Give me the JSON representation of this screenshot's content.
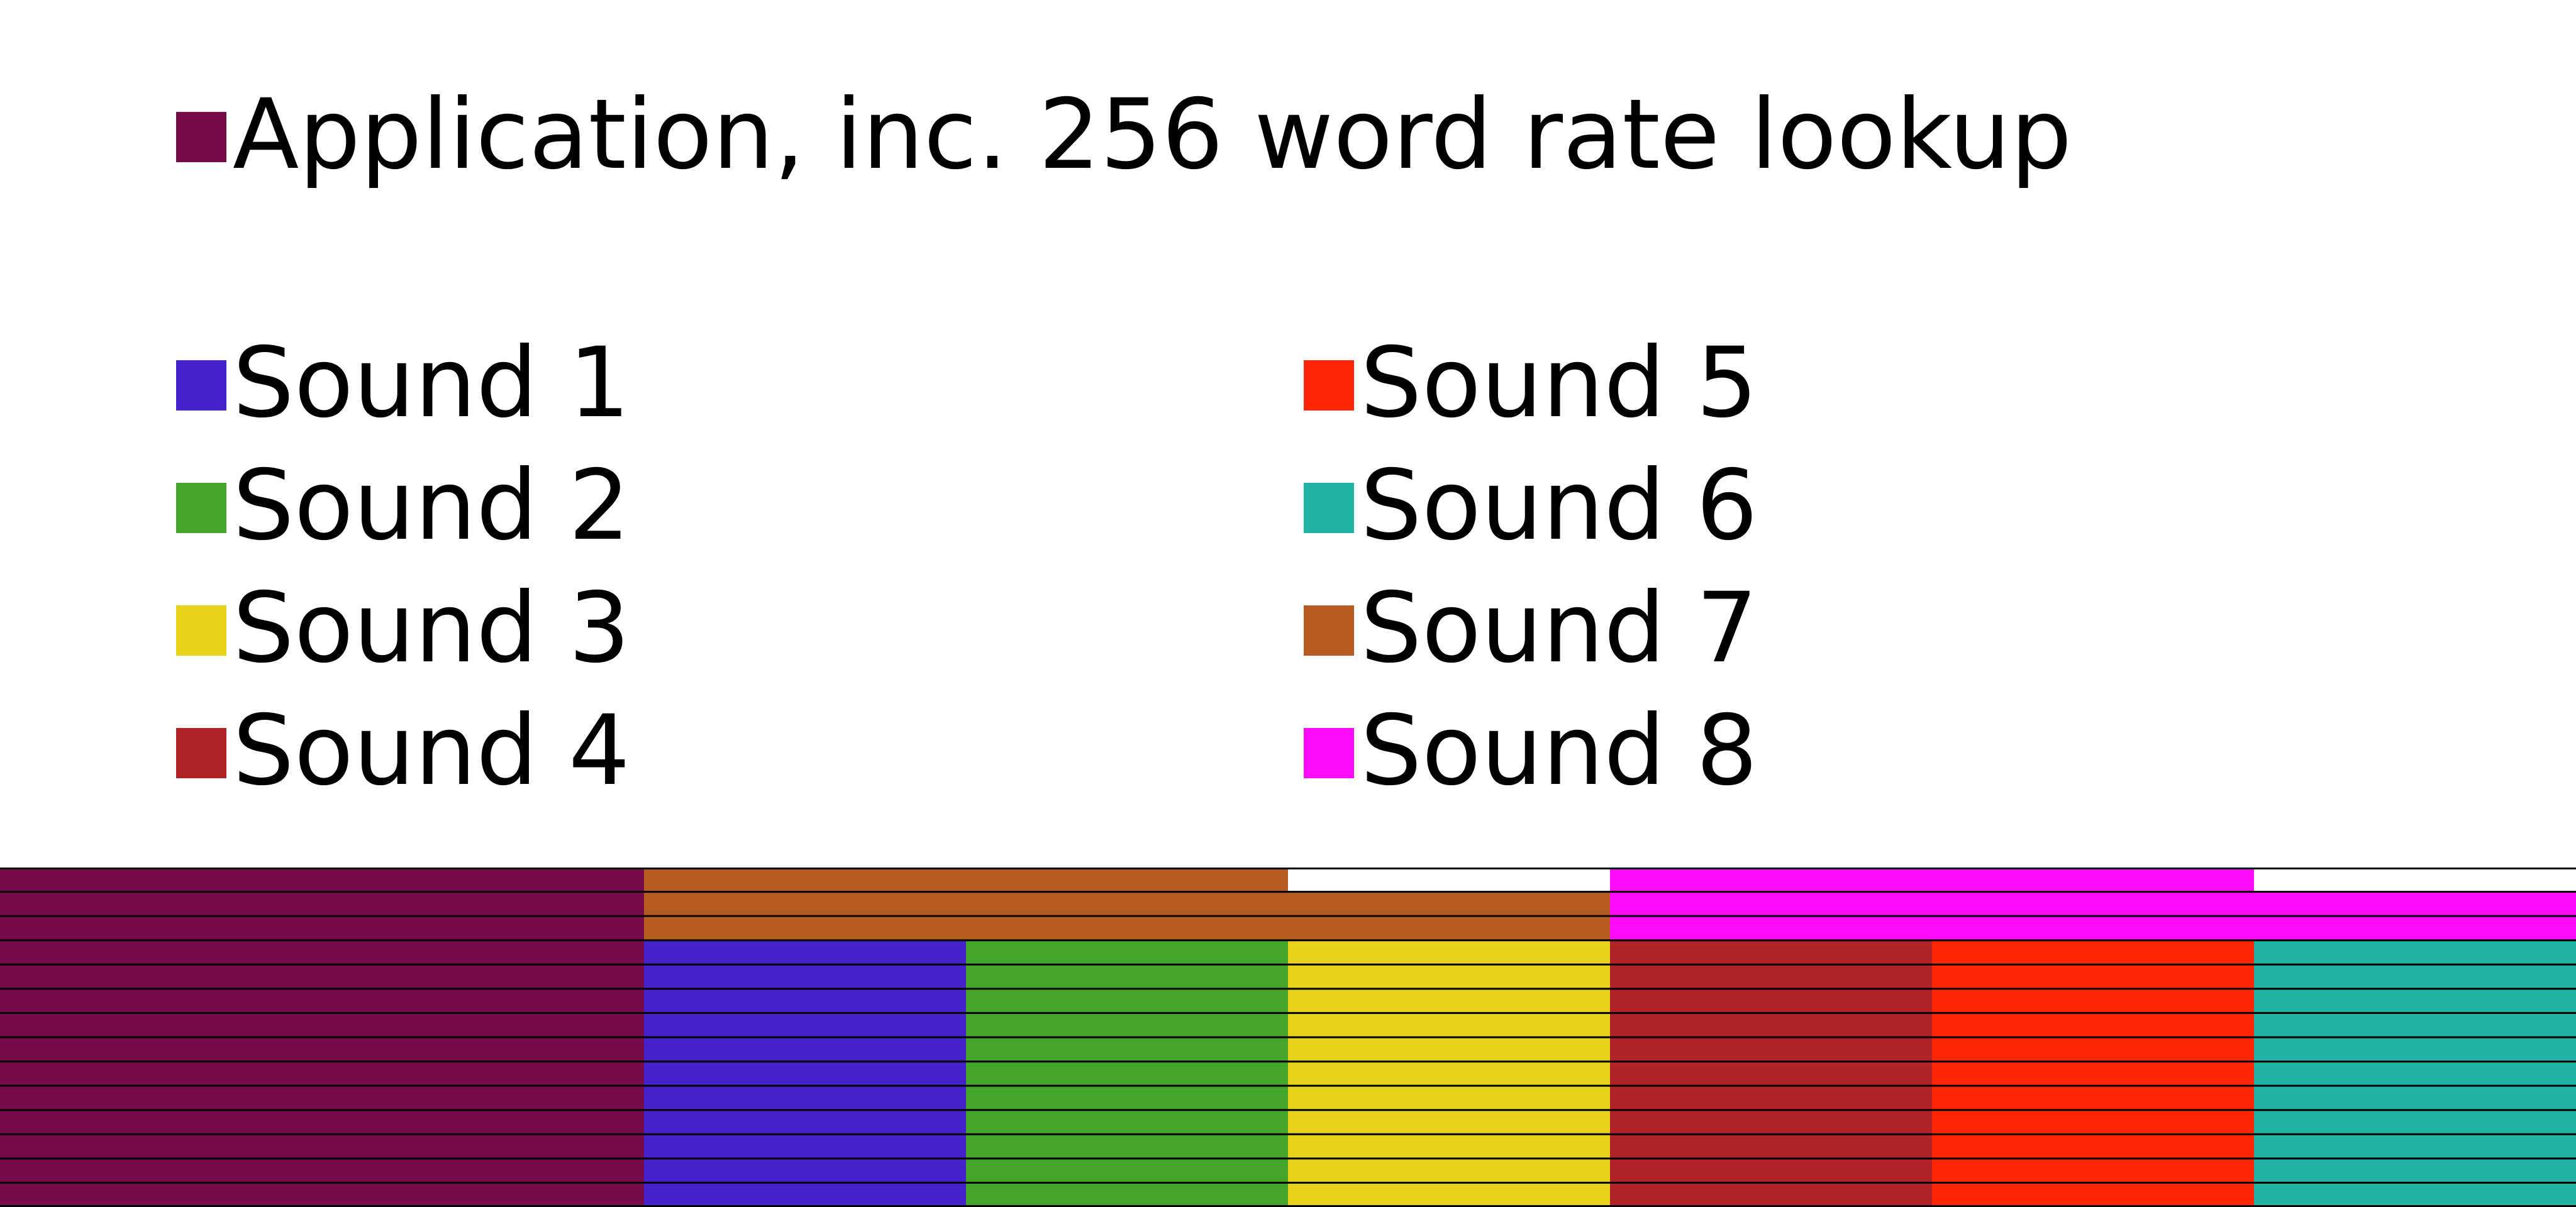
{
  "legend": {
    "application": {
      "label": "Application, inc. 256 word rate lookup",
      "color": "#760b4a"
    },
    "sounds": [
      {
        "label": "Sound 1",
        "color": "#4522cb"
      },
      {
        "label": "Sound 2",
        "color": "#43a62a"
      },
      {
        "label": "Sound 3",
        "color": "#e6d31a"
      },
      {
        "label": "Sound 4",
        "color": "#b12327"
      },
      {
        "label": "Sound 5",
        "color": "#fe2604"
      },
      {
        "label": "Sound 6",
        "color": "#21b3a5"
      },
      {
        "label": "Sound 7",
        "color": "#b65c21"
      },
      {
        "label": "Sound 8",
        "color": "#fd0cfa"
      }
    ]
  },
  "memory_map": {
    "columns": 8,
    "rows": 14,
    "row_spans": [
      [
        {
          "owner": "application",
          "start": 0,
          "end": 2
        },
        {
          "owner": "sound7",
          "start": 2,
          "end": 4
        },
        {
          "owner": "free",
          "start": 4,
          "end": 5
        },
        {
          "owner": "sound8",
          "start": 5,
          "end": 7
        },
        {
          "owner": "free",
          "start": 7,
          "end": 8
        }
      ],
      [
        {
          "owner": "application",
          "start": 0,
          "end": 2
        },
        {
          "owner": "sound7",
          "start": 2,
          "end": 5
        },
        {
          "owner": "sound8",
          "start": 5,
          "end": 8
        }
      ],
      [
        {
          "owner": "application",
          "start": 0,
          "end": 2
        },
        {
          "owner": "sound7",
          "start": 2,
          "end": 5
        },
        {
          "owner": "sound8",
          "start": 5,
          "end": 8
        }
      ],
      [
        {
          "owner": "application",
          "start": 0,
          "end": 2
        },
        {
          "owner": "sound1",
          "start": 2,
          "end": 3
        },
        {
          "owner": "sound2",
          "start": 3,
          "end": 4
        },
        {
          "owner": "sound3",
          "start": 4,
          "end": 5
        },
        {
          "owner": "sound4",
          "start": 5,
          "end": 6
        },
        {
          "owner": "sound5",
          "start": 6,
          "end": 7
        },
        {
          "owner": "sound6",
          "start": 7,
          "end": 8
        }
      ],
      [
        {
          "owner": "application",
          "start": 0,
          "end": 2
        },
        {
          "owner": "sound1",
          "start": 2,
          "end": 3
        },
        {
          "owner": "sound2",
          "start": 3,
          "end": 4
        },
        {
          "owner": "sound3",
          "start": 4,
          "end": 5
        },
        {
          "owner": "sound4",
          "start": 5,
          "end": 6
        },
        {
          "owner": "sound5",
          "start": 6,
          "end": 7
        },
        {
          "owner": "sound6",
          "start": 7,
          "end": 8
        }
      ],
      [
        {
          "owner": "application",
          "start": 0,
          "end": 2
        },
        {
          "owner": "sound1",
          "start": 2,
          "end": 3
        },
        {
          "owner": "sound2",
          "start": 3,
          "end": 4
        },
        {
          "owner": "sound3",
          "start": 4,
          "end": 5
        },
        {
          "owner": "sound4",
          "start": 5,
          "end": 6
        },
        {
          "owner": "sound5",
          "start": 6,
          "end": 7
        },
        {
          "owner": "sound6",
          "start": 7,
          "end": 8
        }
      ],
      [
        {
          "owner": "application",
          "start": 0,
          "end": 2
        },
        {
          "owner": "sound1",
          "start": 2,
          "end": 3
        },
        {
          "owner": "sound2",
          "start": 3,
          "end": 4
        },
        {
          "owner": "sound3",
          "start": 4,
          "end": 5
        },
        {
          "owner": "sound4",
          "start": 5,
          "end": 6
        },
        {
          "owner": "sound5",
          "start": 6,
          "end": 7
        },
        {
          "owner": "sound6",
          "start": 7,
          "end": 8
        }
      ],
      [
        {
          "owner": "application",
          "start": 0,
          "end": 2
        },
        {
          "owner": "sound1",
          "start": 2,
          "end": 3
        },
        {
          "owner": "sound2",
          "start": 3,
          "end": 4
        },
        {
          "owner": "sound3",
          "start": 4,
          "end": 5
        },
        {
          "owner": "sound4",
          "start": 5,
          "end": 6
        },
        {
          "owner": "sound5",
          "start": 6,
          "end": 7
        },
        {
          "owner": "sound6",
          "start": 7,
          "end": 8
        }
      ],
      [
        {
          "owner": "application",
          "start": 0,
          "end": 2
        },
        {
          "owner": "sound1",
          "start": 2,
          "end": 3
        },
        {
          "owner": "sound2",
          "start": 3,
          "end": 4
        },
        {
          "owner": "sound3",
          "start": 4,
          "end": 5
        },
        {
          "owner": "sound4",
          "start": 5,
          "end": 6
        },
        {
          "owner": "sound5",
          "start": 6,
          "end": 7
        },
        {
          "owner": "sound6",
          "start": 7,
          "end": 8
        }
      ],
      [
        {
          "owner": "application",
          "start": 0,
          "end": 2
        },
        {
          "owner": "sound1",
          "start": 2,
          "end": 3
        },
        {
          "owner": "sound2",
          "start": 3,
          "end": 4
        },
        {
          "owner": "sound3",
          "start": 4,
          "end": 5
        },
        {
          "owner": "sound4",
          "start": 5,
          "end": 6
        },
        {
          "owner": "sound5",
          "start": 6,
          "end": 7
        },
        {
          "owner": "sound6",
          "start": 7,
          "end": 8
        }
      ],
      [
        {
          "owner": "application",
          "start": 0,
          "end": 2
        },
        {
          "owner": "sound1",
          "start": 2,
          "end": 3
        },
        {
          "owner": "sound2",
          "start": 3,
          "end": 4
        },
        {
          "owner": "sound3",
          "start": 4,
          "end": 5
        },
        {
          "owner": "sound4",
          "start": 5,
          "end": 6
        },
        {
          "owner": "sound5",
          "start": 6,
          "end": 7
        },
        {
          "owner": "sound6",
          "start": 7,
          "end": 8
        }
      ],
      [
        {
          "owner": "application",
          "start": 0,
          "end": 2
        },
        {
          "owner": "sound1",
          "start": 2,
          "end": 3
        },
        {
          "owner": "sound2",
          "start": 3,
          "end": 4
        },
        {
          "owner": "sound3",
          "start": 4,
          "end": 5
        },
        {
          "owner": "sound4",
          "start": 5,
          "end": 6
        },
        {
          "owner": "sound5",
          "start": 6,
          "end": 7
        },
        {
          "owner": "sound6",
          "start": 7,
          "end": 8
        }
      ],
      [
        {
          "owner": "application",
          "start": 0,
          "end": 2
        },
        {
          "owner": "sound1",
          "start": 2,
          "end": 3
        },
        {
          "owner": "sound2",
          "start": 3,
          "end": 4
        },
        {
          "owner": "sound3",
          "start": 4,
          "end": 5
        },
        {
          "owner": "sound4",
          "start": 5,
          "end": 6
        },
        {
          "owner": "sound5",
          "start": 6,
          "end": 7
        },
        {
          "owner": "sound6",
          "start": 7,
          "end": 8
        }
      ],
      [
        {
          "owner": "application",
          "start": 0,
          "end": 2
        },
        {
          "owner": "sound1",
          "start": 2,
          "end": 3
        },
        {
          "owner": "sound2",
          "start": 3,
          "end": 4
        },
        {
          "owner": "sound3",
          "start": 4,
          "end": 5
        },
        {
          "owner": "sound4",
          "start": 5,
          "end": 6
        },
        {
          "owner": "sound5",
          "start": 6,
          "end": 7
        },
        {
          "owner": "sound6",
          "start": 7,
          "end": 8
        }
      ]
    ],
    "owner_colors": {
      "application": "#760b4a",
      "sound1": "#4522cb",
      "sound2": "#43a62a",
      "sound3": "#e6d31a",
      "sound4": "#b12327",
      "sound5": "#fe2604",
      "sound6": "#21b3a5",
      "sound7": "#b65c21",
      "sound8": "#fd0cfa",
      "free": "#ffffff"
    },
    "line_color": "#000000"
  }
}
